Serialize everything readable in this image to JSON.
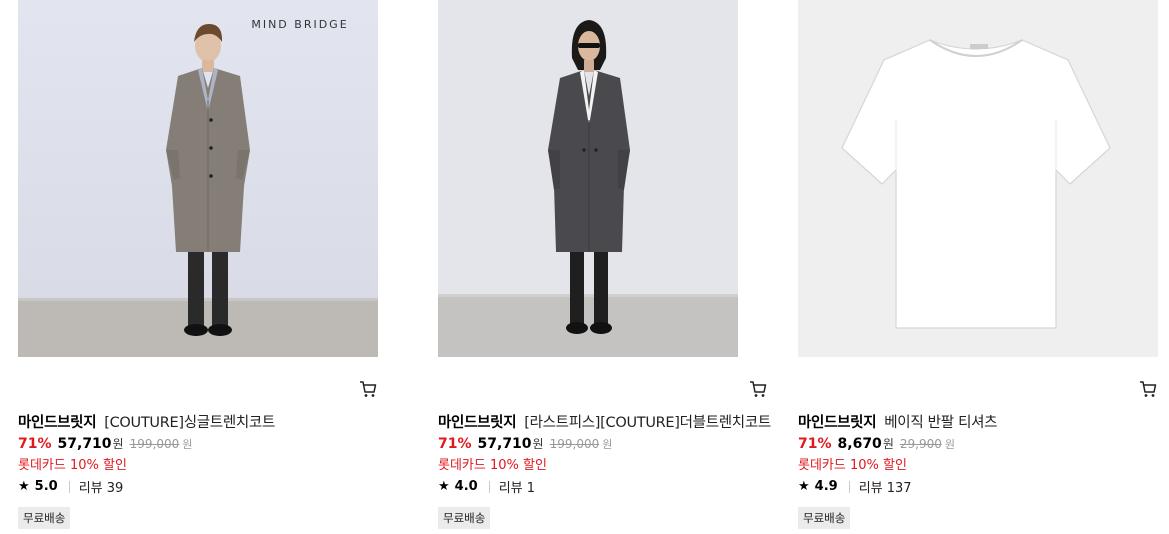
{
  "products": [
    {
      "image_watermark": "MIND BRIDGE",
      "brand": "마인드브릿지",
      "name": "[COUTURE]싱글트렌치코트",
      "discount": "71%",
      "price": "57,710",
      "currency": "원",
      "original_price": "199,000",
      "original_currency": "원",
      "promo": "롯데카드 10% 할인",
      "rating": "5.0",
      "reviews": "리뷰 39",
      "badge": "무료배송"
    },
    {
      "brand": "마인드브릿지",
      "name": "[라스트피스][COUTURE]더블트렌치코트",
      "discount": "71%",
      "price": "57,710",
      "currency": "원",
      "original_price": "199,000",
      "original_currency": "원",
      "promo": "롯데카드 10% 할인",
      "rating": "4.0",
      "reviews": "리뷰 1",
      "badge": "무료배송"
    },
    {
      "brand": "마인드브릿지",
      "name": "베이직 반팔 티셔츠",
      "discount": "71%",
      "price": "8,670",
      "currency": "원",
      "original_price": "29,900",
      "original_currency": "원",
      "promo": "롯데카드 10% 할인",
      "rating": "4.9",
      "reviews": "리뷰 137",
      "badge": "무료배송"
    }
  ],
  "icons": {
    "cart": "cart-icon",
    "star": "star-icon"
  },
  "colors": {
    "discount": "#e0191e",
    "promo": "#e0191e",
    "badge_bg": "#ebebeb"
  }
}
